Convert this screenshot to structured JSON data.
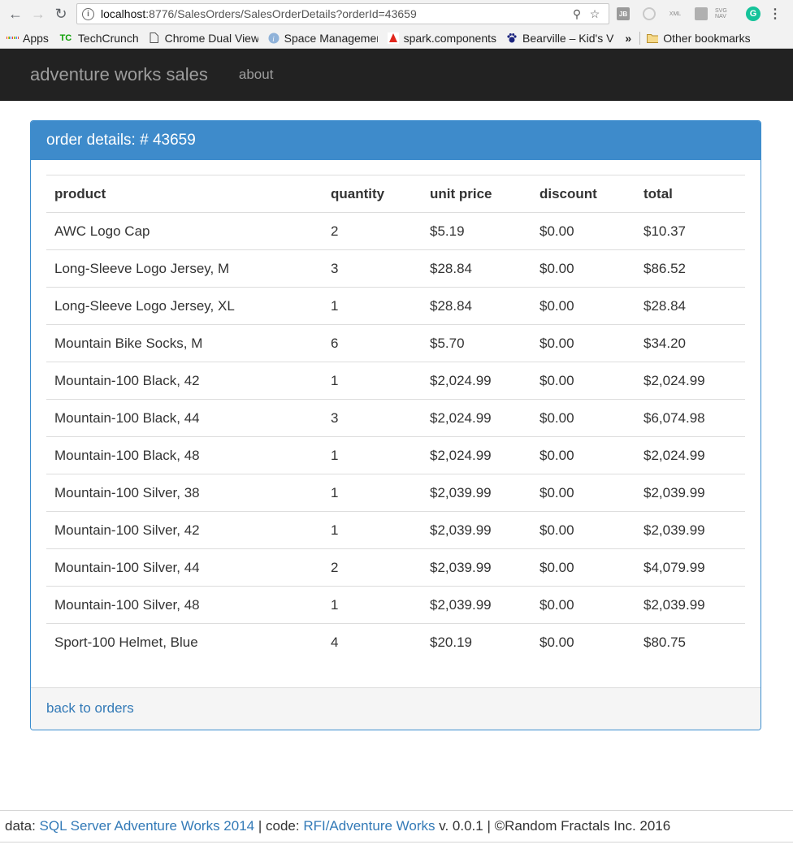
{
  "browser": {
    "url_host": "localhost",
    "url_rest": ":8776/SalesOrders/SalesOrderDetails?orderId=43659",
    "bookmarks": [
      {
        "label": "Apps"
      },
      {
        "label": "TechCrunch",
        "icon_text": "TC"
      },
      {
        "label": "Chrome Dual View"
      },
      {
        "label": "Space Management"
      },
      {
        "label": "spark.components"
      },
      {
        "label": "Bearville – Kid's V"
      }
    ],
    "more": "»",
    "other_bookmarks": "Other bookmarks",
    "ext_labels": [
      "JB",
      "XML",
      "SVG NAV",
      "G"
    ]
  },
  "navbar": {
    "brand": "adventure works sales",
    "about": "about"
  },
  "panel": {
    "title": "order details: # 43659",
    "columns": [
      "product",
      "quantity",
      "unit price",
      "discount",
      "total"
    ],
    "rows": [
      [
        "AWC Logo Cap",
        "2",
        "$5.19",
        "$0.00",
        "$10.37"
      ],
      [
        "Long-Sleeve Logo Jersey, M",
        "3",
        "$28.84",
        "$0.00",
        "$86.52"
      ],
      [
        "Long-Sleeve Logo Jersey, XL",
        "1",
        "$28.84",
        "$0.00",
        "$28.84"
      ],
      [
        "Mountain Bike Socks, M",
        "6",
        "$5.70",
        "$0.00",
        "$34.20"
      ],
      [
        "Mountain-100 Black, 42",
        "1",
        "$2,024.99",
        "$0.00",
        "$2,024.99"
      ],
      [
        "Mountain-100 Black, 44",
        "3",
        "$2,024.99",
        "$0.00",
        "$6,074.98"
      ],
      [
        "Mountain-100 Black, 48",
        "1",
        "$2,024.99",
        "$0.00",
        "$2,024.99"
      ],
      [
        "Mountain-100 Silver, 38",
        "1",
        "$2,039.99",
        "$0.00",
        "$2,039.99"
      ],
      [
        "Mountain-100 Silver, 42",
        "1",
        "$2,039.99",
        "$0.00",
        "$2,039.99"
      ],
      [
        "Mountain-100 Silver, 44",
        "2",
        "$2,039.99",
        "$0.00",
        "$4,079.99"
      ],
      [
        "Mountain-100 Silver, 48",
        "1",
        "$2,039.99",
        "$0.00",
        "$2,039.99"
      ],
      [
        "Sport-100 Helmet, Blue",
        "4",
        "$20.19",
        "$0.00",
        "$80.75"
      ]
    ],
    "back_link": "back to orders"
  },
  "footer": {
    "data_prefix": "data: ",
    "data_link": "SQL Server Adventure Works 2014",
    "code_prefix": " | code: ",
    "code_link": "RFI/Adventure Works",
    "suffix": " v. 0.0.1 | ©Random Fractals Inc. 2016"
  },
  "colors": {
    "navbar_bg": "#222222",
    "panel_heading": "#3e8bcb",
    "link": "#337ab7"
  }
}
